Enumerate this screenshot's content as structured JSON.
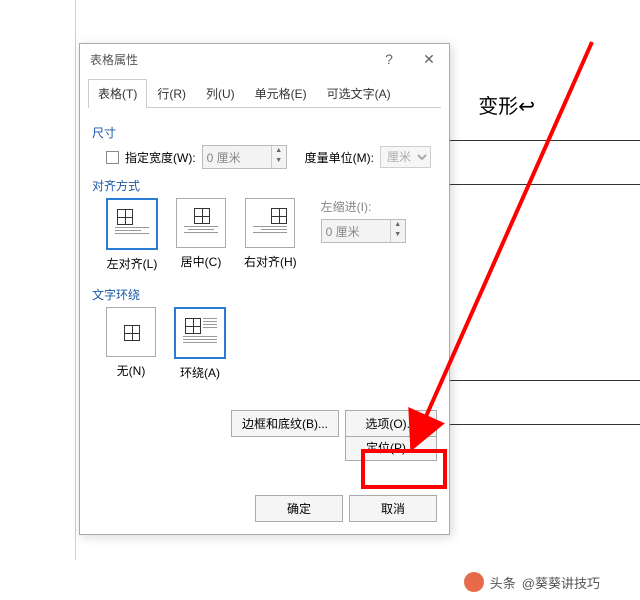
{
  "dialog": {
    "title": "表格属性",
    "help": "?",
    "close": "✕",
    "tabs": {
      "table": "表格(T)",
      "row": "行(R)",
      "column": "列(U)",
      "cell": "单元格(E)",
      "alt": "可选文字(A)"
    },
    "size": {
      "header": "尺寸",
      "width_check": "指定宽度(W):",
      "width_value": "0 厘米",
      "unit_label": "度量单位(M):",
      "unit_value": "厘米"
    },
    "align": {
      "header": "对齐方式",
      "left": "左对齐(L)",
      "center": "居中(C)",
      "right": "右对齐(H)",
      "indent_label": "左缩进(I):",
      "indent_value": "0 厘米"
    },
    "wrap": {
      "header": "文字环绕",
      "none": "无(N)",
      "around": "环绕(A)"
    },
    "buttons": {
      "position": "定位(P)...",
      "borders": "边框和底纹(B)...",
      "options": "选项(O)...",
      "ok": "确定",
      "cancel": "取消"
    }
  },
  "doc": {
    "title_fragment": "变形"
  },
  "watermark": {
    "prefix": "头条",
    "author": "@葵葵讲技巧"
  }
}
